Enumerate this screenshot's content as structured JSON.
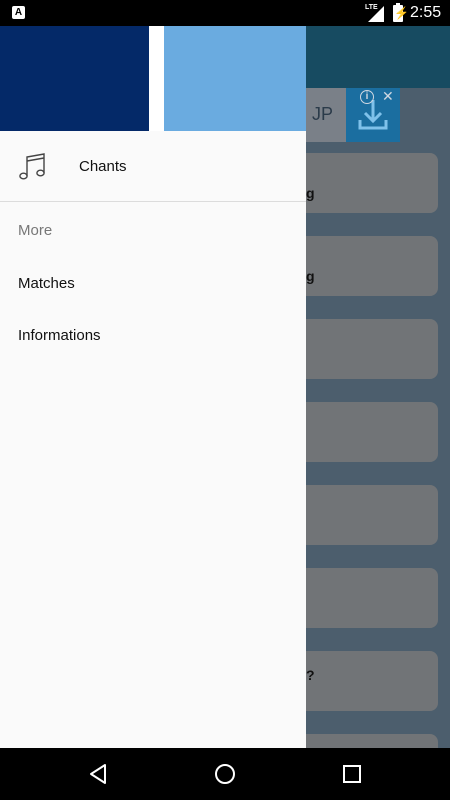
{
  "status_bar": {
    "left_icon_letter": "A",
    "network_label": "LTE",
    "time": "2:55",
    "icons": [
      "notification-a-icon",
      "signal-icon",
      "battery-charging-icon"
    ]
  },
  "background_app": {
    "ad": {
      "text": "JP",
      "icons": [
        "ad-info-icon",
        "ad-close-icon",
        "download-icon"
      ]
    },
    "cards": [
      {
        "text": "g"
      },
      {
        "text": "g"
      },
      {
        "text": ""
      },
      {
        "text": ""
      },
      {
        "text": ""
      },
      {
        "text": ""
      },
      {
        "text": "?"
      },
      {
        "text": ""
      }
    ]
  },
  "drawer": {
    "header_colors": {
      "dark": "#042968",
      "light": "#6aabe0"
    },
    "primary_item": {
      "label": "Chants",
      "icon": "music-note-icon"
    },
    "section_title": "More",
    "items": [
      {
        "label": "Matches"
      },
      {
        "label": "Informations"
      }
    ]
  },
  "nav_bar": {
    "icons": [
      "back-icon",
      "home-icon",
      "recents-icon"
    ]
  }
}
